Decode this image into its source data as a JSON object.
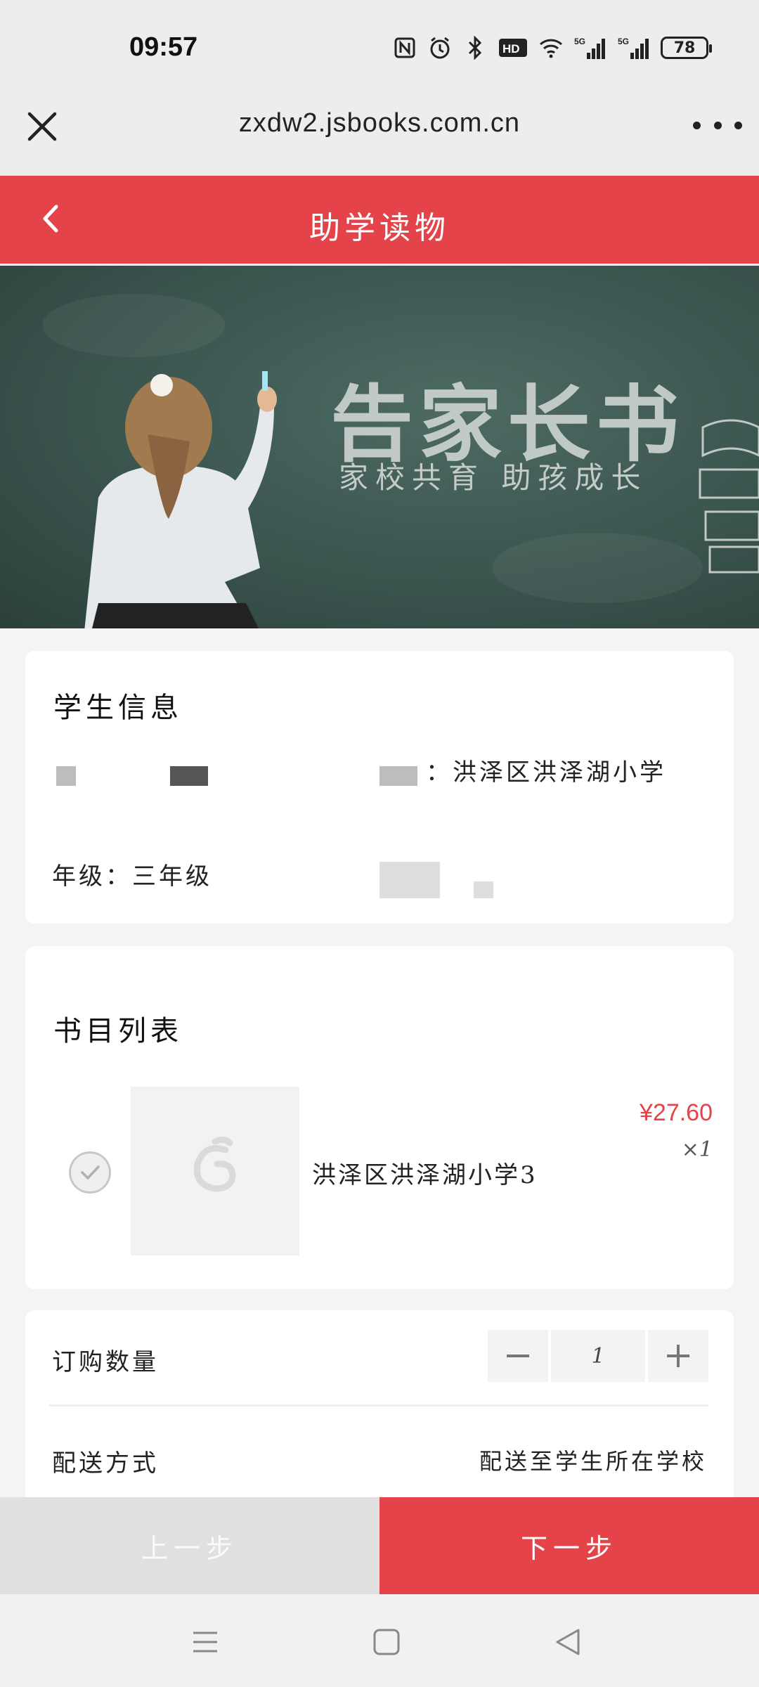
{
  "status_bar": {
    "time": "09:57",
    "icons": [
      "nfc-icon",
      "alarm-icon",
      "bluetooth-icon",
      "hd-icon",
      "wifi-icon",
      "signal-5g-icon",
      "signal-5g-icon"
    ],
    "battery": "78"
  },
  "browser": {
    "url": "zxdw2.jsbooks.com.cn"
  },
  "header": {
    "title": "助学读物"
  },
  "banner": {
    "title": "告家长书",
    "subtitle": "家校共育 助孩成长"
  },
  "student_info": {
    "title": "学生信息",
    "school_value": "：洪泽区洪泽湖小学",
    "grade": "年级：三年级"
  },
  "book_list": {
    "title": "书目列表",
    "items": [
      {
        "name": "洪泽区洪泽湖小学3",
        "price": "¥27.60",
        "qty": "×1"
      }
    ]
  },
  "order": {
    "quantity_label": "订购数量",
    "quantity_value": "1",
    "delivery_label": "配送方式",
    "delivery_value": "配送至学生所在学校"
  },
  "actions": {
    "prev": "上一步",
    "next": "下一步"
  },
  "colors": {
    "accent": "#e44449",
    "price": "#e44449"
  }
}
